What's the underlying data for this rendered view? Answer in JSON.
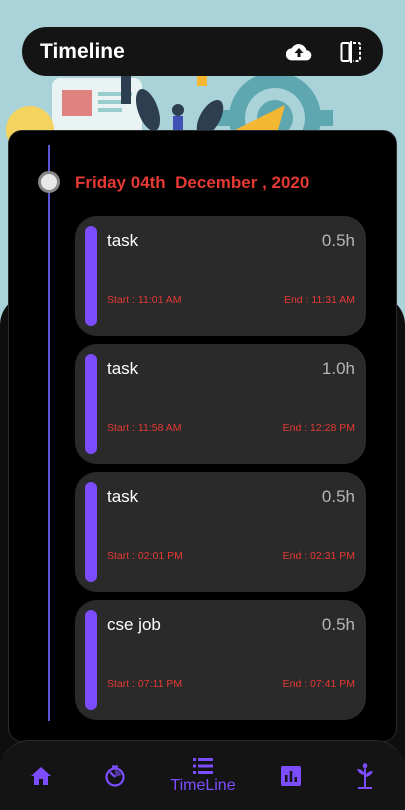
{
  "appbar": {
    "title": "Timeline",
    "actions": [
      {
        "icon": "cloud-upload-icon"
      },
      {
        "icon": "split-view-icon"
      }
    ]
  },
  "timeline": {
    "date_header": "Friday 04th  December , 2020",
    "tasks": [
      {
        "name": "task",
        "duration": "0.5h",
        "start": "Start : 11:01 AM",
        "end": "End : 11:31 AM"
      },
      {
        "name": "task",
        "duration": "1.0h",
        "start": "Start : 11:58 AM",
        "end": "End : 12:28 PM"
      },
      {
        "name": "task",
        "duration": "0.5h",
        "start": "Start : 02:01 PM",
        "end": "End : 02:31 PM"
      },
      {
        "name": "cse job",
        "duration": "0.5h",
        "start": "Start : 07:11 PM",
        "end": "End : 07:41 PM"
      }
    ]
  },
  "bottom_nav": {
    "items": [
      {
        "icon": "home-icon",
        "label": ""
      },
      {
        "icon": "timer-icon",
        "label": ""
      },
      {
        "icon": "list-icon",
        "label": "TimeLine",
        "active": true
      },
      {
        "icon": "bar-chart-icon",
        "label": ""
      },
      {
        "icon": "plant-icon",
        "label": ""
      }
    ]
  },
  "colors": {
    "accent": "#7c4dff",
    "date_red": "#e53935",
    "card_bg": "#2a2a2a",
    "timeline_line": "#5a55d6",
    "illustration_bg": "#a9d3d8"
  }
}
